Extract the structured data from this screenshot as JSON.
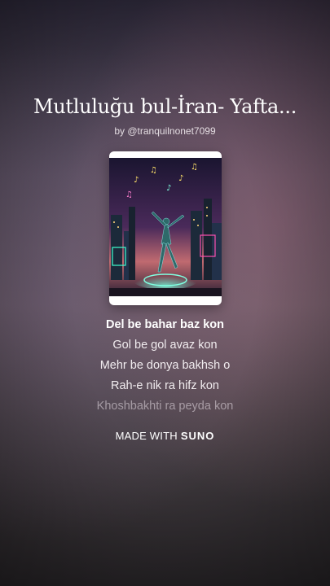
{
  "song": {
    "title": "Mutluluğu bul-İran- Yafta...",
    "byline": "by @tranquilnonet7099"
  },
  "cover_art": {
    "icon": "dancer-neon-city-artwork"
  },
  "lyrics": {
    "lines": [
      "Del be bahar baz kon",
      "Gol be gol avaz kon",
      "Mehr be donya bakhsh o",
      "Rah-e nik ra hifz kon",
      "Khoshbakhti ra peyda kon"
    ],
    "active_index": 0
  },
  "footer": {
    "made_with": "MADE WITH",
    "brand": "SUNO"
  }
}
